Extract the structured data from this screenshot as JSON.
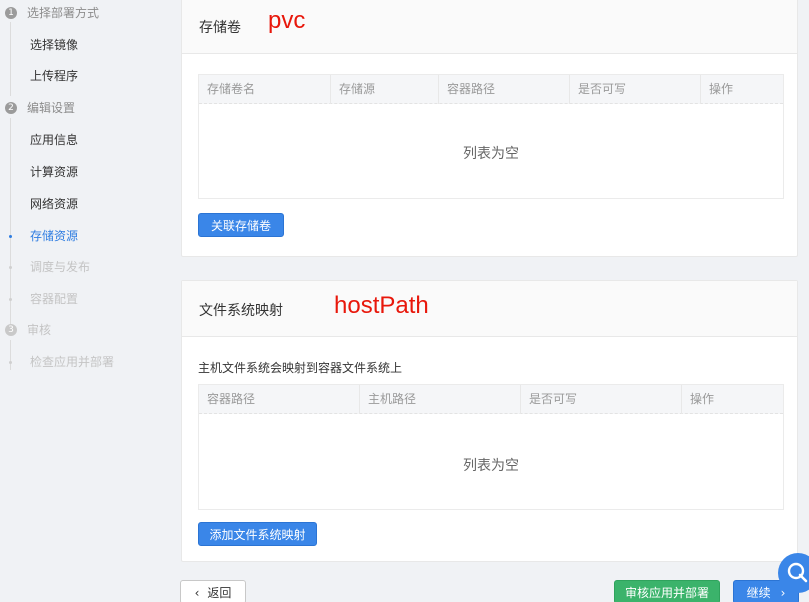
{
  "sidebar": {
    "steps": [
      {
        "num": "1",
        "label": "选择部署方式"
      },
      {
        "num": "2",
        "label": "编辑设置"
      },
      {
        "num": "3",
        "label": "审核"
      }
    ],
    "items": [
      {
        "label": "选择镜像"
      },
      {
        "label": "上传程序"
      },
      {
        "label": "应用信息"
      },
      {
        "label": "计算资源"
      },
      {
        "label": "网络资源"
      },
      {
        "label": "存储资源"
      },
      {
        "label": "调度与发布"
      },
      {
        "label": "容器配置"
      },
      {
        "label": "检查应用并部署"
      }
    ]
  },
  "storage": {
    "title": "存储卷",
    "annotation": "pvc",
    "columns": [
      "存储卷名",
      "存储源",
      "容器路径",
      "是否可写",
      "操作"
    ],
    "empty_text": "列表为空",
    "button": "关联存储卷"
  },
  "hostpath": {
    "title": "文件系统映射",
    "annotation": "hostPath",
    "description": "主机文件系统会映射到容器文件系统上",
    "columns": [
      "容器路径",
      "主机路径",
      "是否可写",
      "操作"
    ],
    "empty_text": "列表为空",
    "button": "添加文件系统映射"
  },
  "footer": {
    "back_icon": "‹",
    "back_label": "返回",
    "review_label": "审核应用并部署",
    "continue_label": "继续",
    "continue_icon": "›"
  },
  "icons": {
    "chat": "chat-bubble-icon"
  },
  "colors": {
    "primary": "#3a86e8",
    "success": "#3bb36b",
    "annotation": "#e8170b"
  }
}
